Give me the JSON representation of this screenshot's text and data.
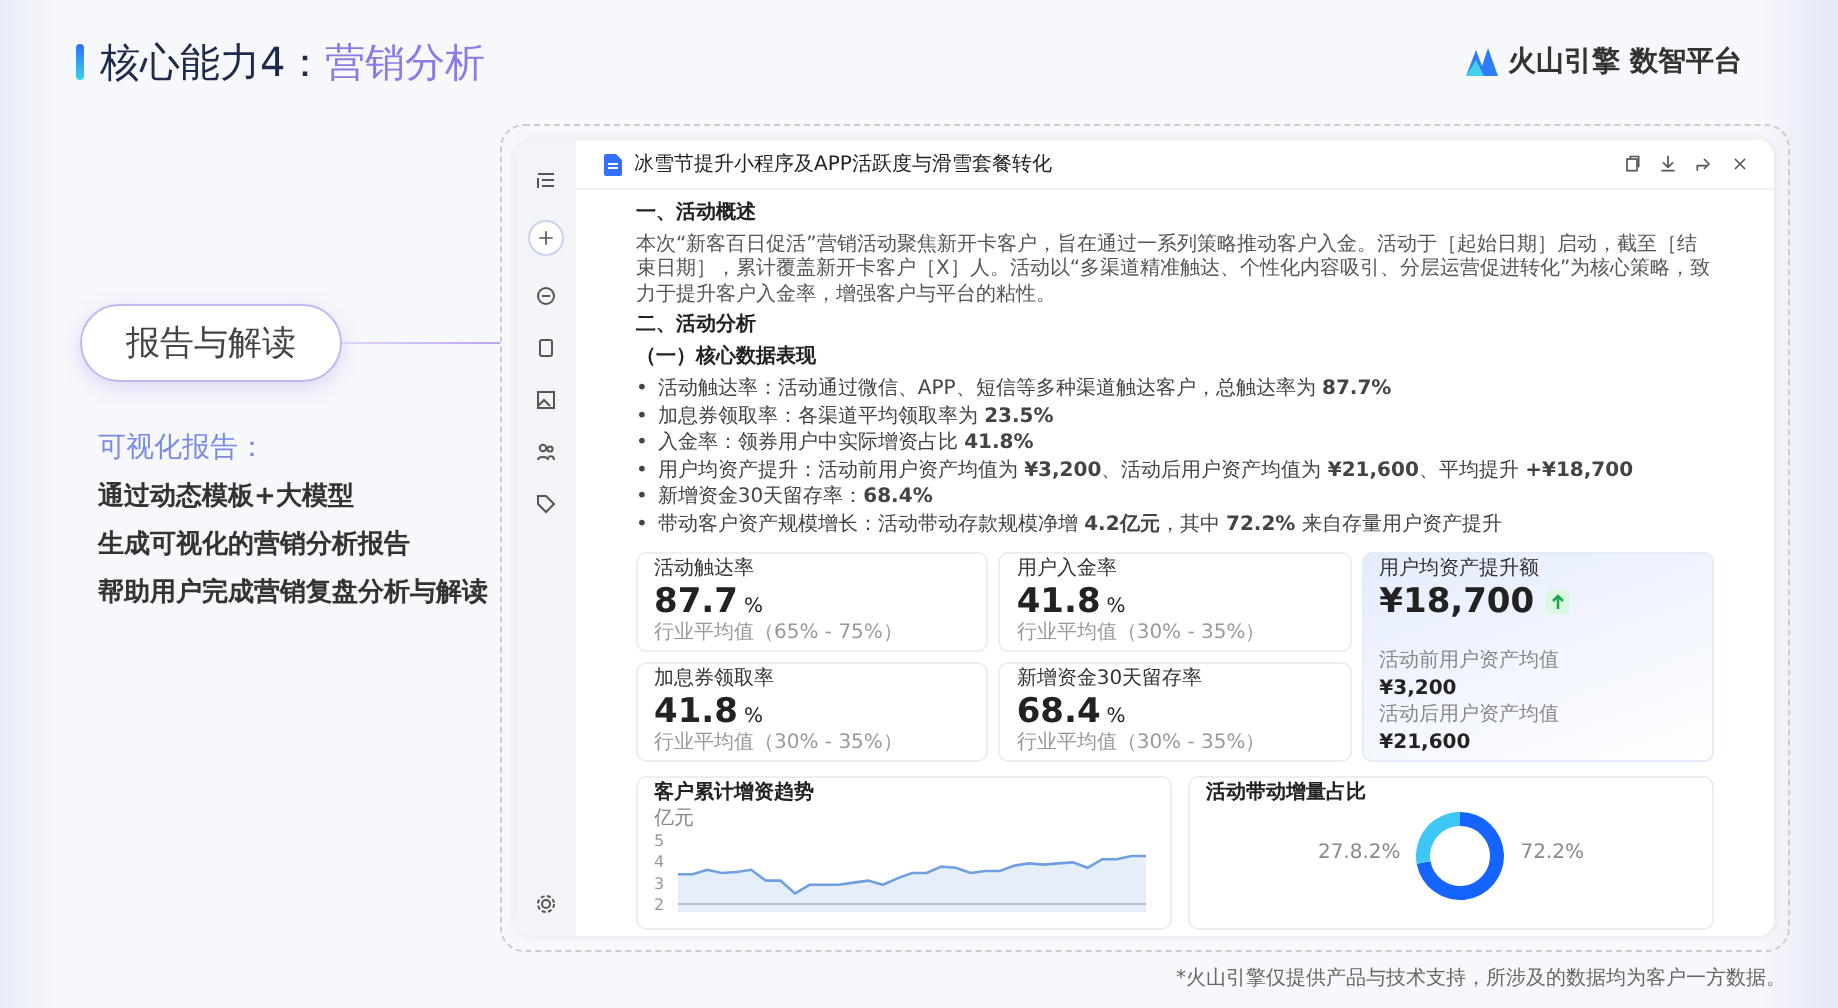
{
  "slide": {
    "title_prefix": "核心能力4：",
    "title_highlight": "营销分析"
  },
  "logo": {
    "text": "火山引擎 数智平台"
  },
  "feature_pill": "报告与解读",
  "feature": {
    "heading": "可视化报告：",
    "lines": [
      "通过动态模板+大模型",
      "生成可视化的营销分析报告",
      "帮助用户完成营销复盘分析与解读"
    ]
  },
  "document": {
    "title": "冰雪节提升小程序及APP活跃度与滑雪套餐转化",
    "section_1": {
      "heading": "一、活动概述",
      "paragraph": "本次“新客百日促活”营销活动聚焦新开卡客户，旨在通过一系列策略推动客户入金。活动于［起始日期］启动，截至［结束日期］，累计覆盖新开卡客户［X］人。活动以“多渠道精准触达、个性化内容吸引、分层运营促进转化”为核心策略，致力于提升客户入金率，增强客户与平台的粘性。"
    },
    "section_2": {
      "heading": "二、活动分析",
      "subheading": "（一）核心数据表现",
      "bullets": [
        {
          "marker": "•",
          "text": "活动触达率：活动通过微信、APP、短信等多种渠道触达客户，总触达率为 **87.7%**"
        },
        {
          "marker": "•",
          "text": "加息券领取率：各渠道平均领取率为 **23.5%**"
        },
        {
          "marker": "•",
          "text": "入金率：领券用户中实际增资占比 **41.8%**"
        },
        {
          "marker": "•",
          "text": "用户均资产提升：活动前用户资产均值为 **¥3,200**、活动后用户资产均值为 **¥21,600**、平均提升 **+¥18,700**"
        },
        {
          "marker": "•",
          "text": "新增资金30天留存率：**68.4%**"
        },
        {
          "marker": "•",
          "text": "带动客户资产规模增长：活动带动存款规模净增 **4.2亿元**，其中 **72.2%** 来自存量用户资产提升"
        }
      ]
    }
  },
  "metrics": [
    {
      "label": "活动触达率",
      "value": "87.7",
      "unit": "%",
      "benchmark": "行业平均值（65% - 75%）"
    },
    {
      "label": "用户入金率",
      "value": "41.8",
      "unit": "%",
      "benchmark": "行业平均值（30% - 35%）"
    },
    {
      "label": "加息券领取率",
      "value": "41.8",
      "unit": "%",
      "benchmark": "行业平均值（30% - 35%）"
    },
    {
      "label": "新增资金30天留存率",
      "value": "68.4",
      "unit": "%",
      "benchmark": "行业平均值（30% - 35%）"
    }
  ],
  "highlight_metric": {
    "label": "用户均资产提升额",
    "value": "¥18,700",
    "details": [
      {
        "label": "活动前用户资产均值",
        "value": "¥3,200"
      },
      {
        "label": "活动后用户资产均值",
        "value": "¥21,600"
      }
    ]
  },
  "charts": [
    {
      "title": "客户累计增资趋势",
      "chart_data": {
        "type": "area",
        "ylabel": "亿元",
        "yticks": [
          2,
          3,
          4,
          5
        ],
        "ylim": [
          2,
          5
        ],
        "series": [
          {
            "color": "#6f9fe0",
            "values": [
              3.4,
              3.4,
              3.6,
              3.45,
              3.5,
              3.6,
              3.1,
              3.1,
              2.5,
              2.9,
              2.9,
              2.9,
              3.0,
              3.1,
              2.9,
              3.2,
              3.45,
              3.45,
              3.75,
              3.7,
              3.45,
              3.55,
              3.55,
              3.8,
              3.9,
              3.85,
              3.9,
              3.95,
              3.7,
              4.1,
              4.1,
              4.25,
              4.25
            ]
          }
        ]
      }
    },
    {
      "title": "活动带动增量占比",
      "chart_data": {
        "type": "donut",
        "values": [
          72.2,
          27.8
        ],
        "value_labels": [
          "72.2%",
          "27.8.2%"
        ]
      }
    }
  ],
  "footnote": "*火山引擎仅提供产品与技术支持，所涉及的数据均为客户一方数据。"
}
